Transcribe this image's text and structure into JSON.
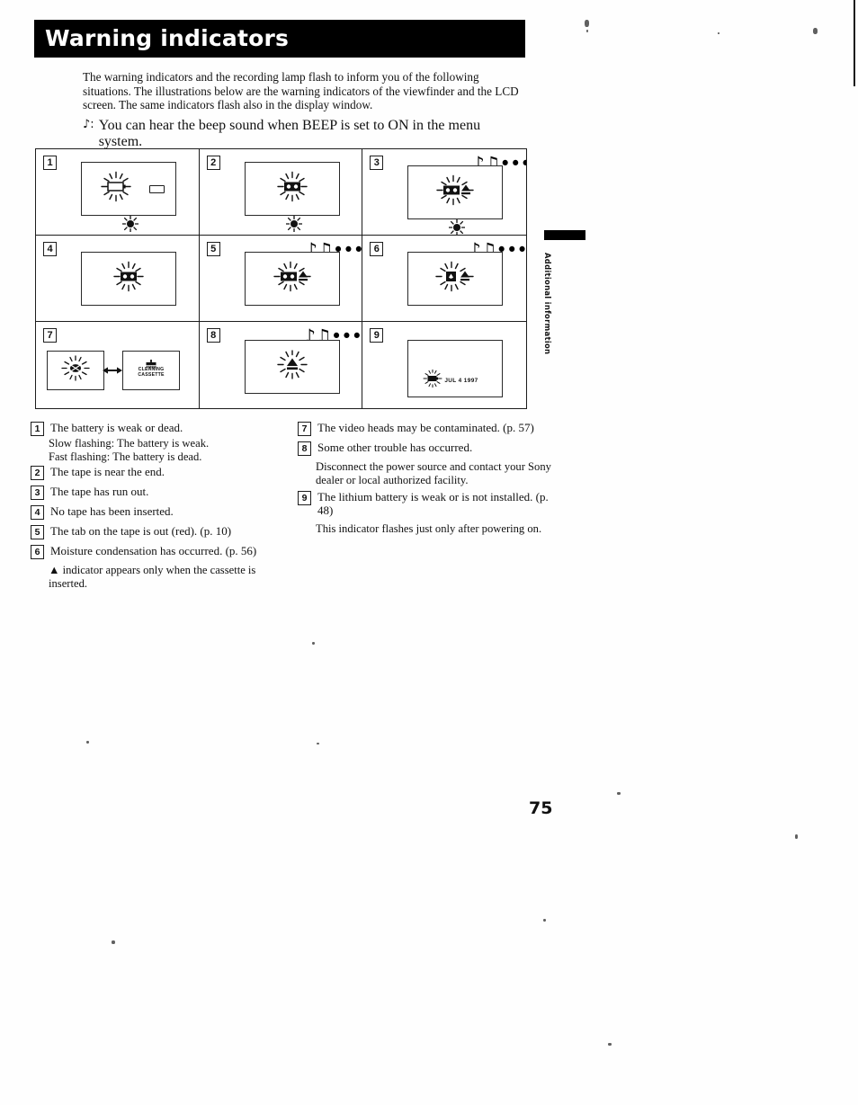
{
  "header": {
    "title": "Warning indicators"
  },
  "intro": {
    "paragraph1": "The warning indicators and the recording lamp flash to inform you of the following situations.  The illustrations below are the warning indicators of the viewfinder and the LCD screen. The same indicators flash also in the display window.",
    "beep_note_glyph": "♪:",
    "beep_text": "You can hear the beep sound when BEEP is set to ON in the menu system."
  },
  "grid": {
    "cells": [
      {
        "number": "1",
        "icon": "battery-flashing-icon",
        "has_notes": false,
        "has_rec_lamp": true,
        "has_battery_bar": true
      },
      {
        "number": "2",
        "icon": "cassette-flashing-icon",
        "has_notes": false,
        "has_rec_lamp": true,
        "has_battery_bar": false
      },
      {
        "number": "3",
        "icon": "cassette-eject-flashing-icon",
        "has_notes": true,
        "has_rec_lamp": true,
        "has_battery_bar": false
      },
      {
        "number": "4",
        "icon": "cassette-flashing-icon",
        "has_notes": false,
        "has_rec_lamp": false,
        "has_battery_bar": false
      },
      {
        "number": "5",
        "icon": "cassette-eject-flashing-icon",
        "has_notes": true,
        "has_rec_lamp": false,
        "has_battery_bar": false
      },
      {
        "number": "6",
        "icon": "moisture-eject-flashing-icon",
        "has_notes": true,
        "has_rec_lamp": false,
        "has_battery_bar": false
      },
      {
        "number": "7",
        "icon": "cleaning-cassette-icon",
        "has_notes": false,
        "has_rec_lamp": false,
        "has_battery_bar": false
      },
      {
        "number": "8",
        "icon": "eject-flashing-icon",
        "has_notes": true,
        "has_rec_lamp": false,
        "has_battery_bar": false
      },
      {
        "number": "9",
        "icon": "lithium-battery-flashing-icon",
        "has_notes": false,
        "has_rec_lamp": false,
        "has_battery_bar": false
      }
    ],
    "notes_glyph": "♪♫•••",
    "cleaning_cassette_line1": "CLEANING",
    "cleaning_cassette_line2": "CASSETTE",
    "date_text": "JUL 4 1997"
  },
  "legend_left": {
    "item1_num": "1",
    "item1_text": "The battery is weak or dead.",
    "item1_sub1": "Slow flashing: The battery is weak.",
    "item1_sub2": "Fast flashing: The battery is dead.",
    "item2_num": "2",
    "item2_text": "The tape is near the end.",
    "item3_num": "3",
    "item3_text": "The tape has run out.",
    "item4_num": "4",
    "item4_text": "No tape has been inserted.",
    "item5_num": "5",
    "item5_text": "The tab on the tape is out (red). (p. 10)",
    "item6_num": "6",
    "item6_text": "Moisture condensation has occurred. (p. 56)",
    "item6_sub": "▲ indicator appears only when the cassette is inserted."
  },
  "legend_right": {
    "item7_num": "7",
    "item7_text": "The video heads may be contaminated. (p. 57)",
    "item8_num": "8",
    "item8_text": "Some other trouble has occurred.",
    "item8_sub": "Disconnect the power source and contact your Sony dealer or local authorized facility.",
    "item9_num": "9",
    "item9_text": "The lithium battery is weak or is not installed. (p. 48)",
    "item9_sub": "This indicator flashes just only after powering on."
  },
  "side_tab": {
    "label": "Additional information"
  },
  "folio": {
    "page_number": "75"
  }
}
